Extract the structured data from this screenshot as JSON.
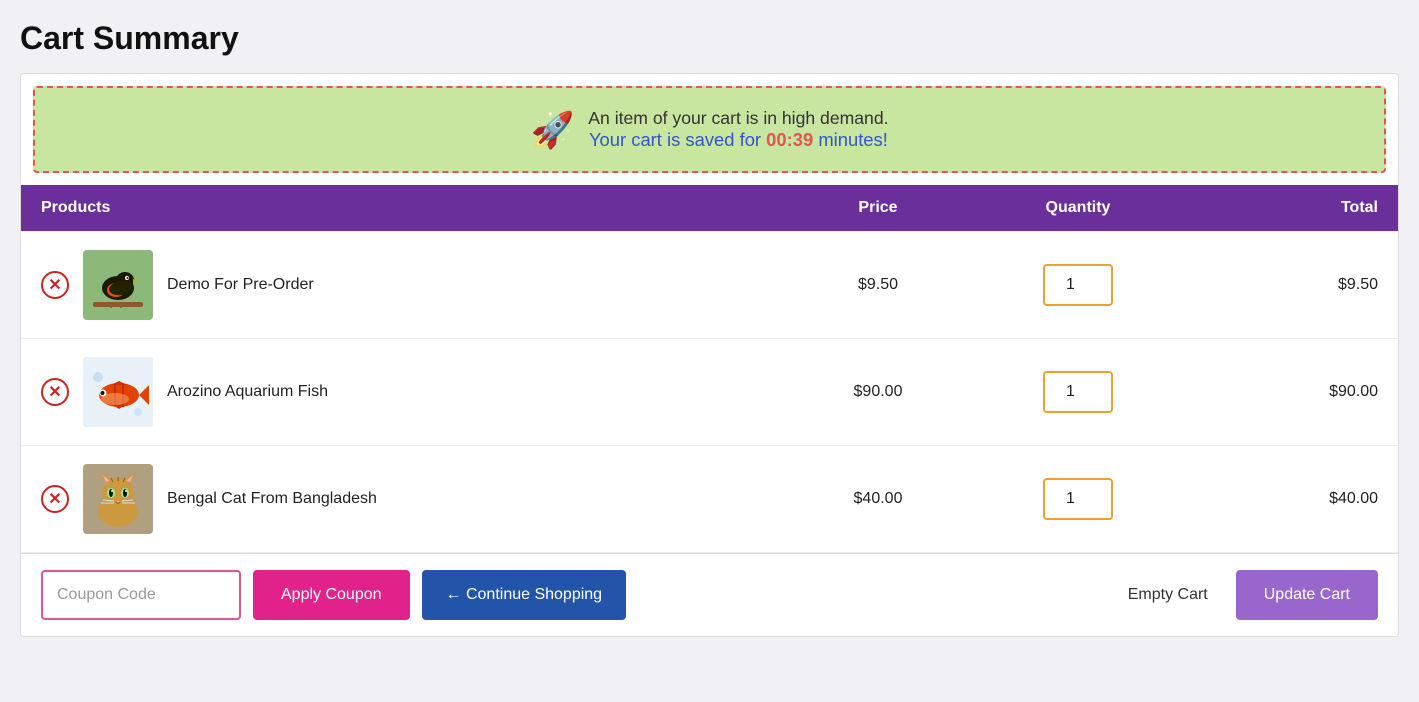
{
  "page": {
    "title": "Cart Summary"
  },
  "alert": {
    "icon": "🚀",
    "line1": "An item of your cart is in high demand.",
    "line2_prefix": "Your cart is saved for ",
    "timer": "00:39",
    "line2_suffix": " minutes!"
  },
  "table": {
    "headers": {
      "products": "Products",
      "price": "Price",
      "quantity": "Quantity",
      "total": "Total"
    },
    "rows": [
      {
        "id": "row-1",
        "name": "Demo For Pre-Order",
        "price": "$9.50",
        "quantity": 1,
        "total": "$9.50",
        "thumb_type": "bird"
      },
      {
        "id": "row-2",
        "name": "Arozino Aquarium Fish",
        "price": "$90.00",
        "quantity": 1,
        "total": "$90.00",
        "thumb_type": "fish"
      },
      {
        "id": "row-3",
        "name": "Bengal Cat From Bangladesh",
        "price": "$40.00",
        "quantity": 1,
        "total": "$40.00",
        "thumb_type": "cat"
      }
    ]
  },
  "footer": {
    "coupon_placeholder": "Coupon Code",
    "apply_coupon_label": "Apply Coupon",
    "continue_shopping_label": "← Continue Shopping",
    "empty_cart_label": "Empty Cart",
    "update_cart_label": "Update Cart"
  }
}
